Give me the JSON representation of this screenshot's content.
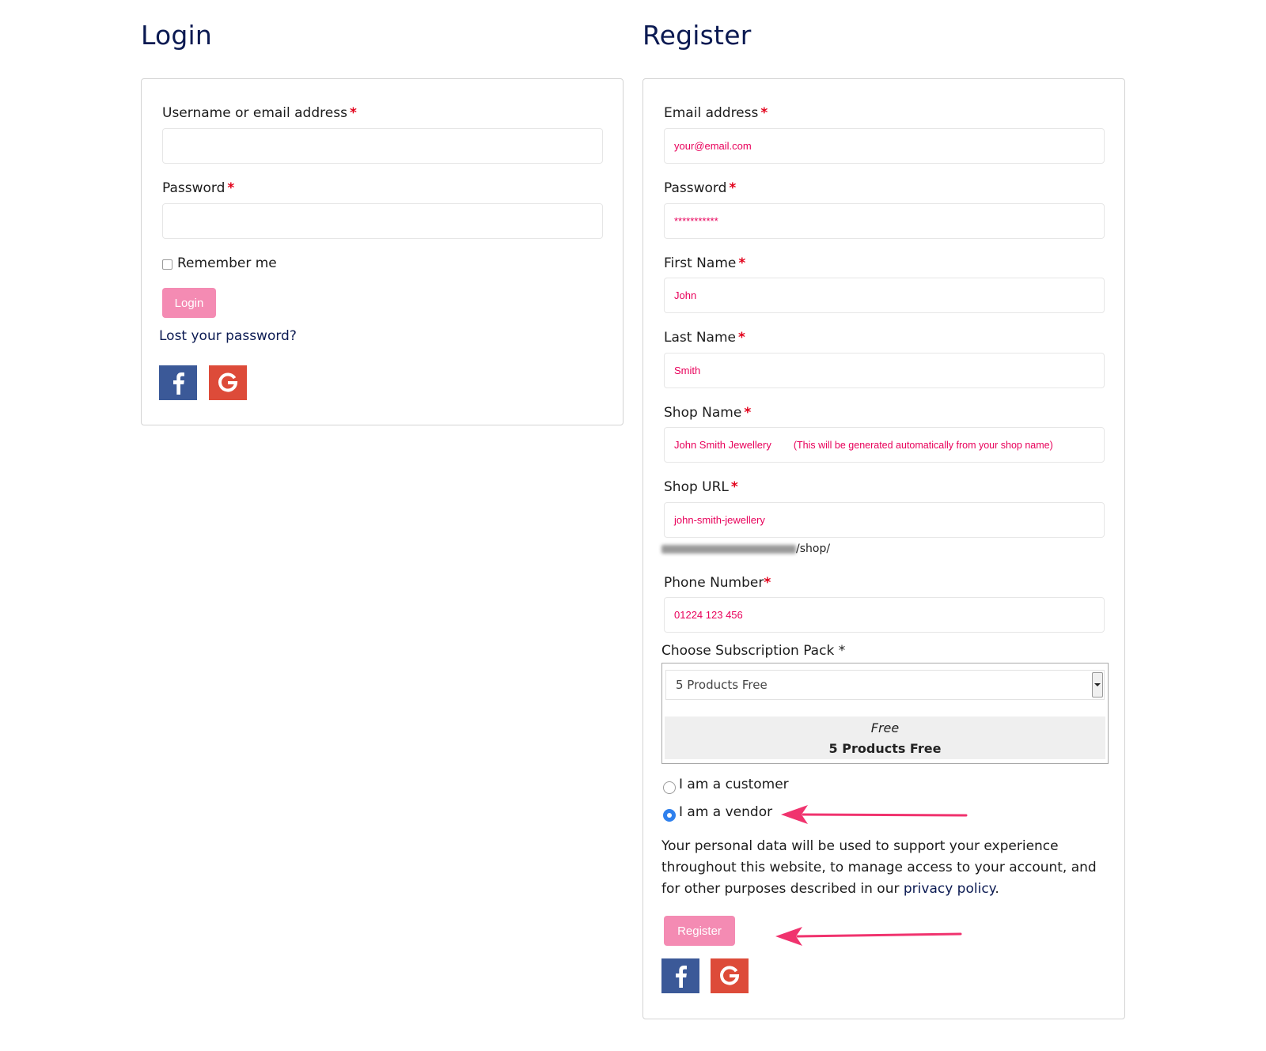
{
  "login": {
    "heading": "Login",
    "username_label": "Username or email address",
    "username_value": "",
    "password_label": "Password",
    "password_value": "",
    "remember_label": "Remember me",
    "login_button": "Login",
    "lost_password": "Lost your password?"
  },
  "register": {
    "heading": "Register",
    "email_label": "Email address",
    "email_value": "your@email.com",
    "password_label": "Password",
    "password_value": "***********",
    "first_name_label": "First Name",
    "first_name_value": "John",
    "last_name_label": "Last Name",
    "last_name_value": "Smith",
    "shop_name_label": "Shop Name",
    "shop_name_value": "John Smith Jewellery",
    "shop_name_note": "(This will be generated automatically from your shop name)",
    "shop_url_label": "Shop URL",
    "shop_url_value": "john-smith-jewellery",
    "shop_url_suffix": "/shop/",
    "phone_label": "Phone Number",
    "phone_value": "01224 123 456",
    "subscription_label": "Choose Subscription Pack *",
    "subscription_selected": "5 Products Free",
    "subscription_price": "Free",
    "subscription_pack_name": "5 Products Free",
    "radio_customer": "I am a customer",
    "radio_vendor": "I am a vendor",
    "radio_selected": "vendor",
    "privacy_text": "Your personal data will be used to support your experience throughout this website, to manage access to your account, and for other purposes described in our",
    "privacy_link": "privacy policy",
    "privacy_end": ".",
    "register_button": "Register"
  },
  "required_mark": "*",
  "colors": {
    "heading": "#0b1a52",
    "accent_pink": "#f48bb3",
    "input_text": "#e8005a",
    "annotation_arrow": "#f0336e",
    "facebook": "#3b5998",
    "google": "#dd4b39"
  },
  "icons": [
    "facebook-icon",
    "google-icon",
    "annotation-arrow"
  ]
}
